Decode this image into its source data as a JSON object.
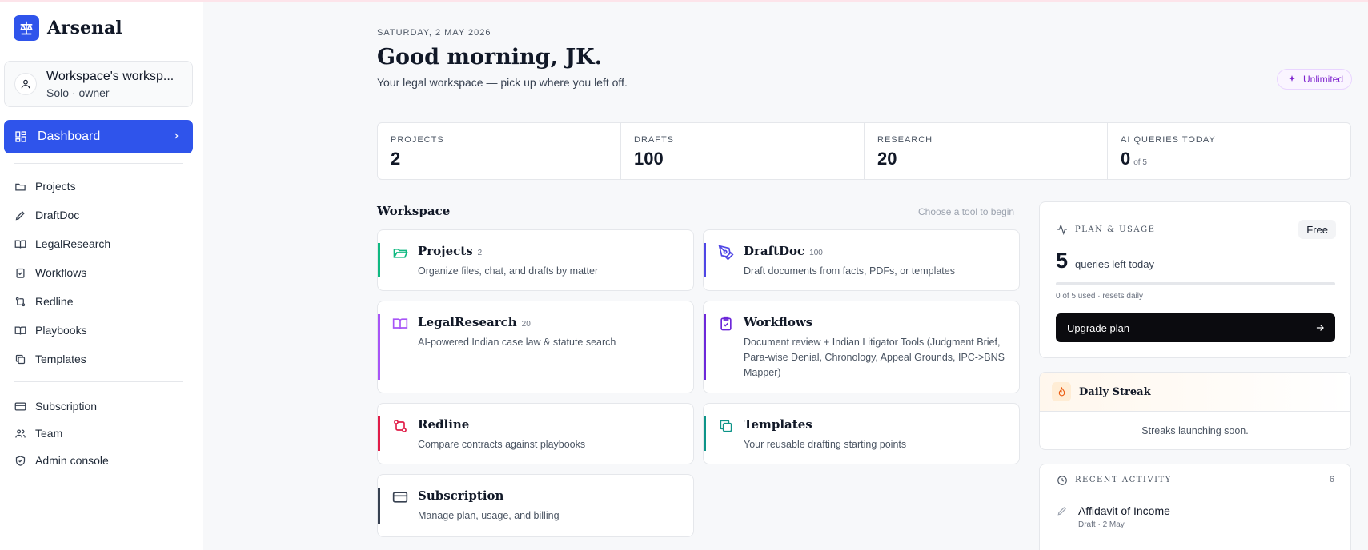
{
  "app": {
    "name": "Arsenal"
  },
  "workspace": {
    "name": "Workspace's worksp...",
    "role": "Solo · owner"
  },
  "nav": {
    "active": "Dashboard",
    "items": [
      "Projects",
      "DraftDoc",
      "LegalResearch",
      "Workflows",
      "Redline",
      "Playbooks",
      "Templates"
    ],
    "secondary": [
      "Subscription",
      "Team",
      "Admin console"
    ]
  },
  "header": {
    "date": "SATURDAY, 2 MAY 2026",
    "greeting": "Good morning, JK.",
    "subtitle": "Your legal workspace — pick up where you left off.",
    "badge": "Unlimited"
  },
  "stats": [
    {
      "label": "PROJECTS",
      "value": "2",
      "suffix": ""
    },
    {
      "label": "DRAFTS",
      "value": "100",
      "suffix": ""
    },
    {
      "label": "RESEARCH",
      "value": "20",
      "suffix": ""
    },
    {
      "label": "AI QUERIES TODAY",
      "value": "0",
      "suffix": "of 5"
    }
  ],
  "workspace_section": {
    "title": "Workspace",
    "hint": "Choose a tool to begin",
    "tools": [
      {
        "name": "Projects",
        "count": "2",
        "desc": "Organize files, chat, and drafts by matter",
        "color": "#10b981"
      },
      {
        "name": "DraftDoc",
        "count": "100",
        "desc": "Draft documents from facts, PDFs, or templates",
        "color": "#4f46e5"
      },
      {
        "name": "LegalResearch",
        "count": "20",
        "desc": "AI-powered Indian case law & statute search",
        "color": "#a855f7"
      },
      {
        "name": "Workflows",
        "count": "",
        "desc": "Document review + Indian Litigator Tools (Judgment Brief, Para-wise Denial, Chronology, Appeal Grounds, IPC->BNS Mapper)",
        "color": "#6d28d9"
      },
      {
        "name": "Redline",
        "count": "",
        "desc": "Compare contracts against playbooks",
        "color": "#e11d48"
      },
      {
        "name": "Templates",
        "count": "",
        "desc": "Your reusable drafting starting points",
        "color": "#0d9488"
      },
      {
        "name": "Subscription",
        "count": "",
        "desc": "Manage plan, usage, and billing",
        "color": "#374151"
      }
    ]
  },
  "plan": {
    "title": "PLAN & USAGE",
    "tier": "Free",
    "queries_left": "5",
    "queries_label": "queries left today",
    "used_fraction": 0,
    "used_text": "0 of 5 used · resets daily",
    "upgrade_label": "Upgrade plan"
  },
  "streak": {
    "title": "Daily Streak",
    "message": "Streaks launching soon."
  },
  "recent": {
    "title": "RECENT ACTIVITY",
    "count": "6",
    "items": [
      {
        "title": "Affidavit of Income",
        "type": "Draft",
        "date": "2 May"
      }
    ]
  },
  "colors": {
    "accent": "#2f54eb",
    "unlimited": "#7e22ce"
  }
}
